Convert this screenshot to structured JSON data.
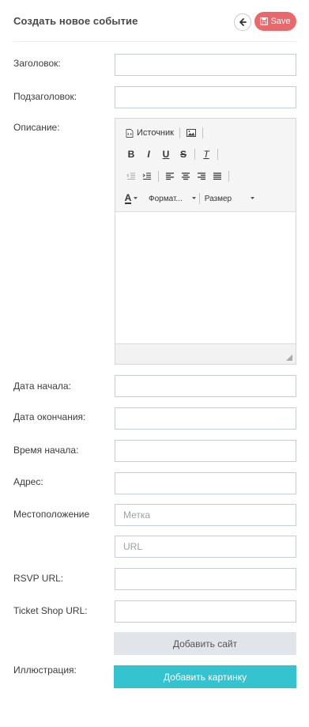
{
  "header": {
    "title": "Создать новое событие",
    "save_label": "Save"
  },
  "labels": {
    "heading": "Заголовок:",
    "subheading": "Подзаголовок:",
    "description": "Описание:",
    "start_date": "Дата начала:",
    "end_date": "Дата окончания:",
    "start_time": "Время начала:",
    "address": "Адрес:",
    "location": "Местоположение",
    "rsvp_url": "RSVP URL:",
    "ticket_shop_url": "Ticket Shop URL:",
    "illustration": "Иллюстрация:"
  },
  "fields": {
    "heading": "",
    "subheading": "",
    "start_date": "",
    "end_date": "",
    "start_time": "",
    "address": "",
    "location_label_placeholder": "Метка",
    "location_url_placeholder": "URL",
    "rsvp_url": "",
    "ticket_shop_url": ""
  },
  "editor": {
    "source_label": "Источник",
    "format_label": "Формат...",
    "size_label": "Размер",
    "bold": "B",
    "italic": "I",
    "underline": "U",
    "strike": "S",
    "remove_format": "T",
    "text_color": "A"
  },
  "buttons": {
    "add_site": "Добавить сайт",
    "add_image": "Добавить картинку"
  },
  "colors": {
    "save": "#e8686b",
    "add_image": "#34c3cf",
    "add_site": "#e1e4e8"
  }
}
